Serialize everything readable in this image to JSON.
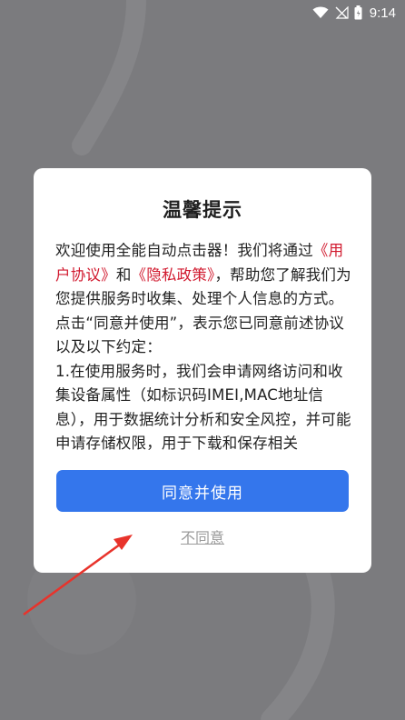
{
  "status_bar": {
    "time": "9:14",
    "icons": [
      "wifi-icon",
      "signal-off-icon",
      "battery-icon"
    ]
  },
  "dialog": {
    "title": "温馨提示",
    "body": {
      "intro_prefix": "欢迎使用全能自动点击器！我们将通过",
      "user_agreement": "《用户协议》",
      "and": "和",
      "privacy_policy": "《隐私政策》",
      "intro_suffix": "，帮助您了解我们为您提供服务时收集、处理个人信息的方式。",
      "para2": "点击“同意并使用”，表示您已同意前述协议以及以下约定：",
      "para3": "1.在使用服务时，我们会申请网络访问和收集设备属性（如标识码IMEI,MAC地址信息），用于数据统计分析和安全风控，并可能申请存储权限，用于下载和保存相关"
    },
    "agree_label": "同意并使用",
    "disagree_label": "不同意"
  },
  "colors": {
    "overlay": "#7b7b7e",
    "accent": "#3476ec",
    "link": "#d1192e",
    "arrow": "#e8332b"
  }
}
